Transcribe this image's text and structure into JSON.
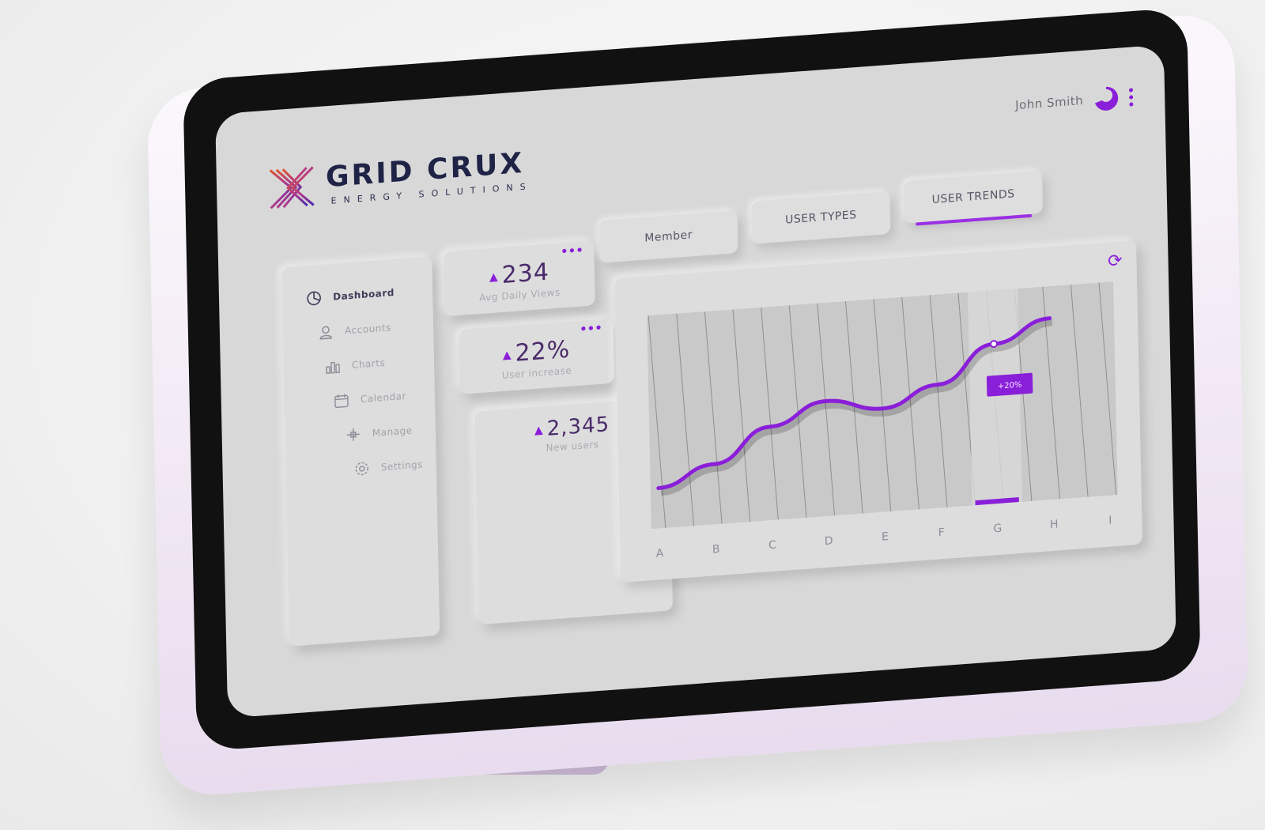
{
  "brand": {
    "title": "GRID CRUX",
    "subtitle": "ENERGY SOLUTIONS"
  },
  "user": {
    "name": "John Smith"
  },
  "sidebar": {
    "items": [
      {
        "label": "Dashboard",
        "icon": "dashboard-icon",
        "active": true
      },
      {
        "label": "Accounts",
        "icon": "user-icon",
        "active": false
      },
      {
        "label": "Charts",
        "icon": "bar-chart-icon",
        "active": false
      },
      {
        "label": "Calendar",
        "icon": "calendar-icon",
        "active": false
      },
      {
        "label": "Manage",
        "icon": "move-icon",
        "active": false
      },
      {
        "label": "Settings",
        "icon": "gear-icon",
        "active": false
      }
    ]
  },
  "stats": [
    {
      "value": "234",
      "label": "Avg Daily Views"
    },
    {
      "value": "22%",
      "label": "User increase"
    },
    {
      "value": "2,345",
      "label": "New users"
    }
  ],
  "tabs": [
    {
      "label": "Member",
      "active": false
    },
    {
      "label": "USER TYPES",
      "active": false
    },
    {
      "label": "USER TRENDS",
      "active": true
    }
  ],
  "colors": {
    "accent": "#8a1fd9",
    "screen_bg": "#d8d8d8",
    "card_bg": "#dddddd",
    "brand_dark": "#1f2346"
  },
  "chart_data": {
    "type": "line",
    "categories": [
      "A",
      "B",
      "C",
      "D",
      "E",
      "F",
      "G",
      "H",
      "I"
    ],
    "values": [
      10,
      22,
      42,
      55,
      48,
      60,
      82,
      95,
      null
    ],
    "highlight": {
      "category": "G",
      "label": "+20%"
    }
  }
}
